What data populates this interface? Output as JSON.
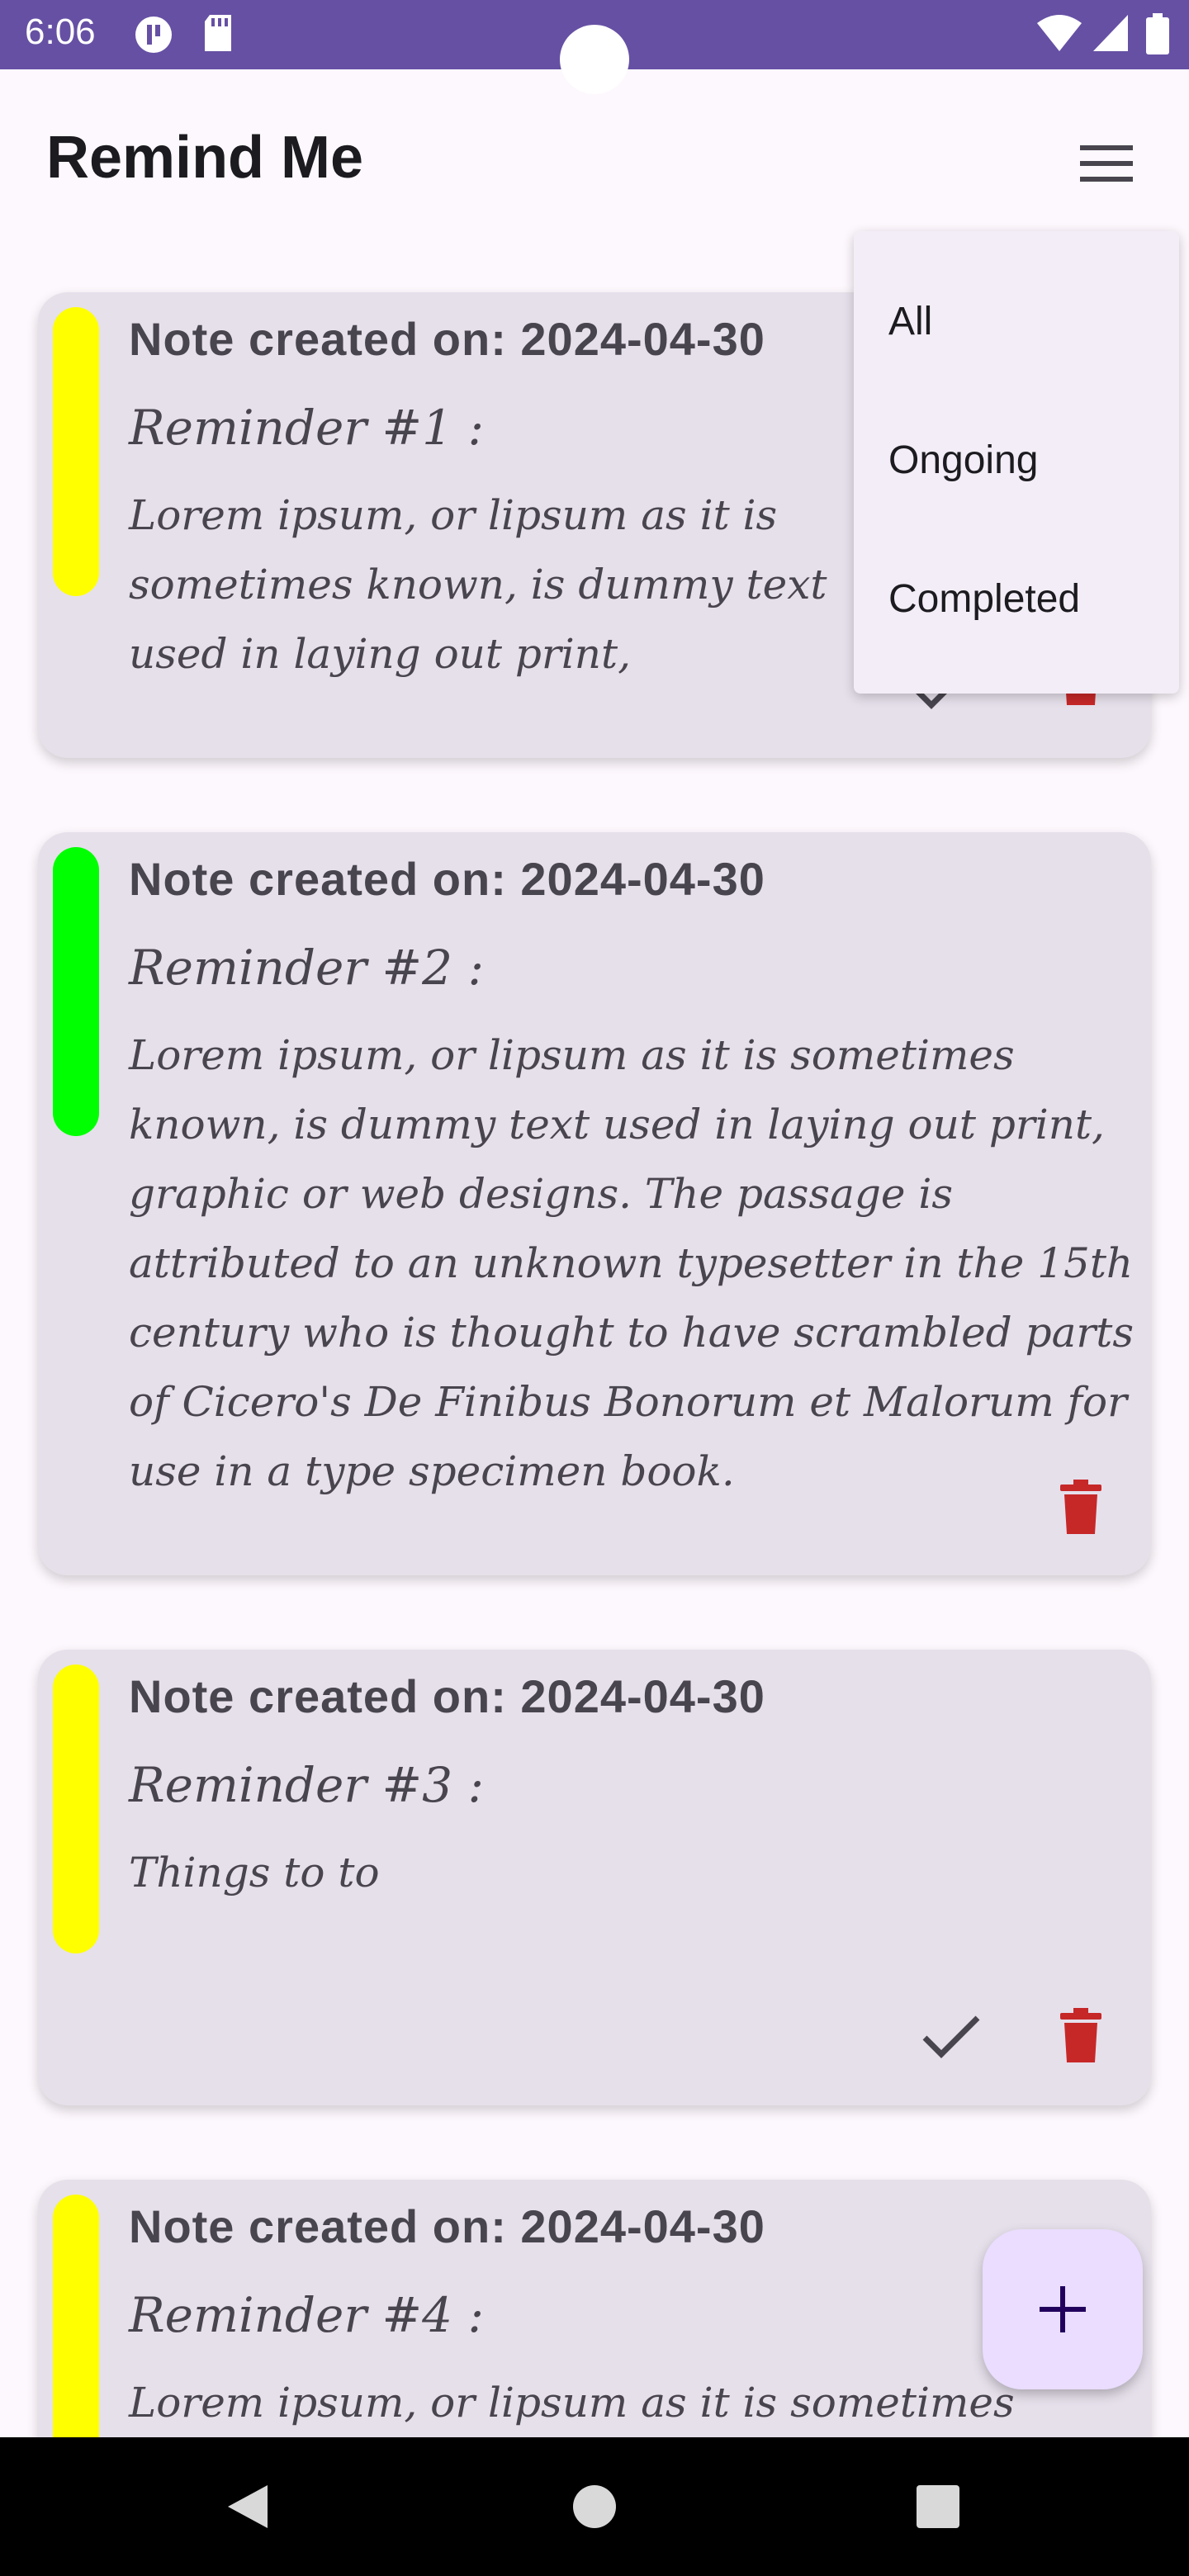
{
  "status_bar": {
    "time": "6:06"
  },
  "app": {
    "title": "Remind Me"
  },
  "notes": [
    {
      "date": "Note created on: 2024-04-30",
      "title": "Reminder #1 :",
      "body": "Lorem ipsum, or lipsum as it is sometimes known, is dummy text used in laying out print,",
      "color": "#ffff00"
    },
    {
      "date": "Note created on: 2024-04-30",
      "title": "Reminder #2 :",
      "body": "Lorem ipsum, or lipsum as it is sometimes known, is dummy text used in laying out print, graphic or web designs. The passage is attributed to an unknown typesetter in the 15th century who is thought to have scrambled parts of Cicero's De Finibus Bonorum et Malorum for use in a type specimen book.",
      "color": "#00ff00"
    },
    {
      "date": "Note created on: 2024-04-30",
      "title": "Reminder #3 :",
      "body": "Things to to",
      "color": "#ffff00"
    },
    {
      "date": "Note created on: 2024-04-30",
      "title": "Reminder #4 :",
      "body": "Lorem ipsum, or lipsum as it is sometimes known, is",
      "color": "#ffff00"
    }
  ],
  "filter_menu": {
    "items": [
      "All",
      "Ongoing",
      "Completed"
    ]
  },
  "colors": {
    "status_bar": "#6650a4",
    "card": "#e6e0eb",
    "delete": "#c62828",
    "fab": "#eaddff"
  },
  "icons": {
    "menu": "hamburger-menu-icon",
    "check": "check-icon",
    "delete": "trash-icon",
    "add": "plus-icon"
  }
}
